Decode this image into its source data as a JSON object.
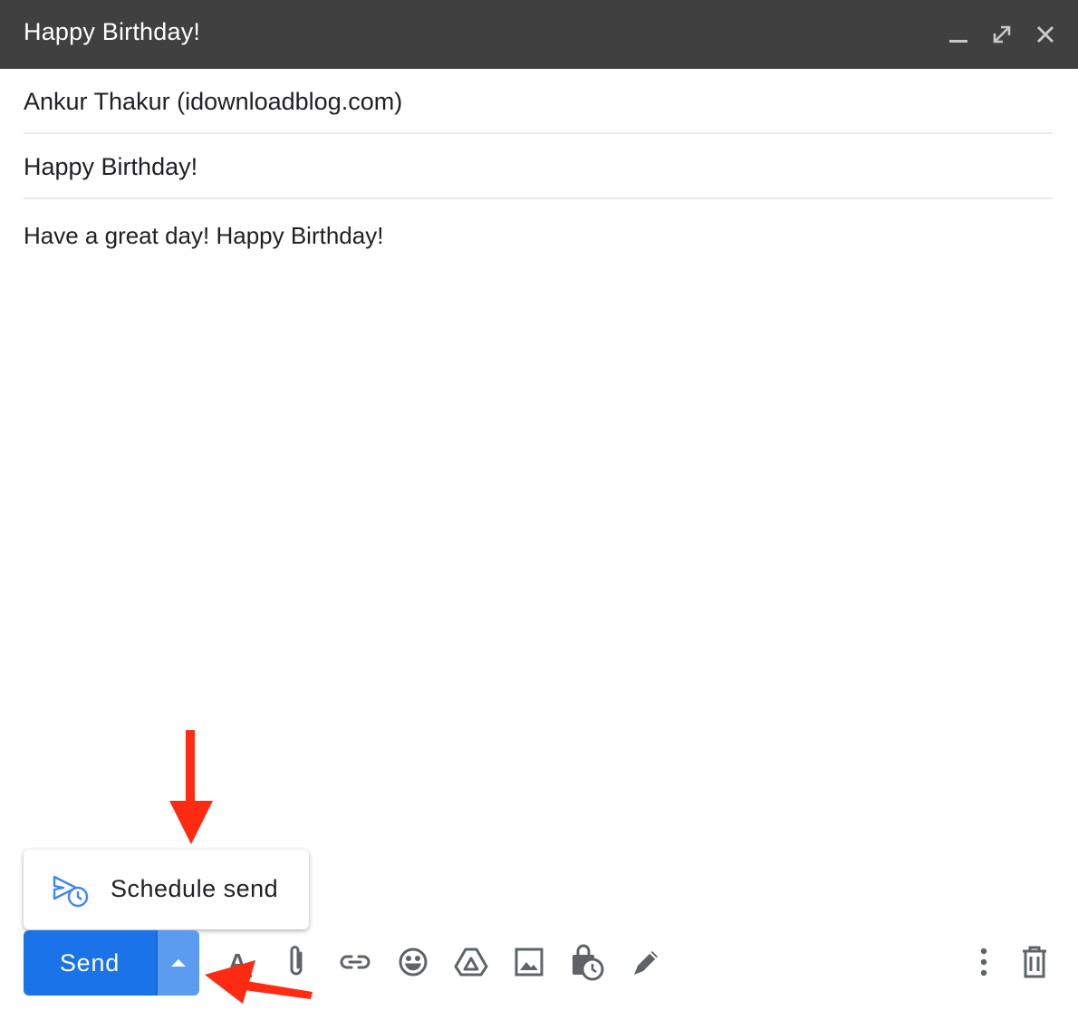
{
  "compose": {
    "window_title": "Happy Birthday!",
    "to": "Ankur Thakur (idownloadblog.com)",
    "subject": "Happy Birthday!",
    "body": "Have a great day! Happy Birthday!"
  },
  "window_controls": [
    "minimize-icon",
    "expand-icon",
    "close-icon"
  ],
  "schedule_menu": {
    "label": "Schedule send",
    "icon": "schedule-send-icon"
  },
  "send_button": {
    "label": "Send",
    "more_options_icon": "caret-up-icon"
  },
  "toolbar": {
    "left_tools": [
      "formatting-options-icon",
      "attach-files-icon",
      "insert-link-icon",
      "insert-emoji-icon",
      "google-drive-icon",
      "insert-photo-icon",
      "confidential-mode-icon",
      "insert-signature-icon"
    ],
    "right_tools": [
      "more-options-icon",
      "discard-draft-icon"
    ]
  },
  "annotation_arrows": [
    "red-arrow-pointing-down",
    "red-arrow-pointing-left"
  ],
  "colors": {
    "titlebar": "#404040",
    "send_button": "#1a73e8",
    "send_more_highlight": "#5b9bf0",
    "annotation_arrow": "#ff2a12",
    "icon": "#5f6368"
  }
}
